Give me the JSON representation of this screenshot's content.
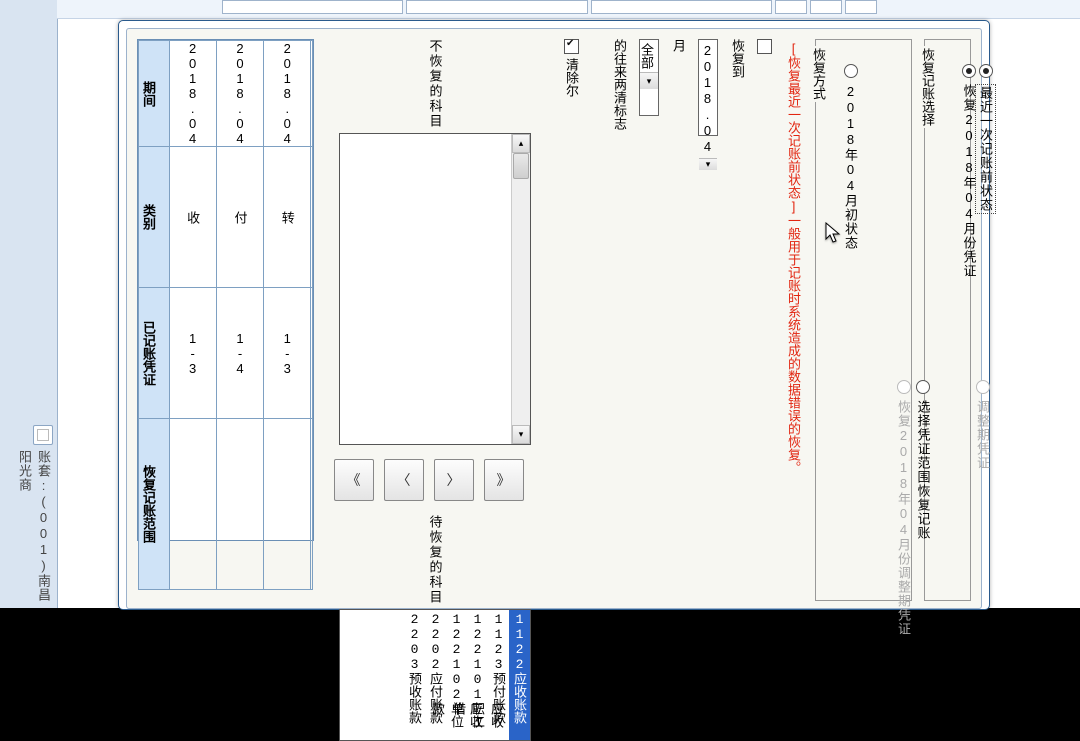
{
  "taskbar_label": "账套:(001)南昌阳光商",
  "dialog": {
    "group_restore_select": {
      "title": "恢复记账选择",
      "opt_restore_month": "恢复2018年04月份凭证",
      "opt_adjust": "调整期凭证"
    },
    "group_method": {
      "title": "恢复方式",
      "opt_last": "最近一次记账前状态",
      "opt_to_month_start": "2018年04月初状态",
      "opt_restore_adjust": "恢复2018年04月份调整期凭证",
      "opt_range": "选择凭证范围恢复记账",
      "hint": "[恢复最近一次记账前状态]一般用于记账时系统造成的数据错误的恢复。"
    },
    "restore_line": {
      "label": "恢复到",
      "period": "2018.04",
      "unit": "月",
      "all": "全部",
      "suffix": "的往来两清标志",
      "clear_label": "清除尔"
    },
    "lists": {
      "left_label": "不恢复的科目",
      "right_label": "待恢复的科目",
      "right_items": [
        {
          "code": "1122",
          "name": "应收账款"
        },
        {
          "code": "1123",
          "name": "预付账款"
        },
        {
          "code": "122101",
          "name": "应收职工借"
        },
        {
          "code": "122102",
          "name": "应收单位款"
        },
        {
          "code": "2202",
          "name": "应付账款"
        },
        {
          "code": "2203",
          "name": "预收账款"
        }
      ]
    },
    "arrows": {
      "all_right": "》",
      "one_right": "〉",
      "one_left": "〈",
      "all_left": "《"
    },
    "table": {
      "headers": [
        "期间",
        "类别",
        "已记账凭证",
        "恢复记账范围"
      ],
      "rows": [
        {
          "c1": "2018.04",
          "c2": "收",
          "c3": "1-3",
          "c4": ""
        },
        {
          "c1": "2018.04",
          "c2": "付",
          "c3": "1-4",
          "c4": ""
        },
        {
          "c1": "2018.04",
          "c2": "转",
          "c3": "1-3",
          "c4": ""
        }
      ]
    }
  }
}
